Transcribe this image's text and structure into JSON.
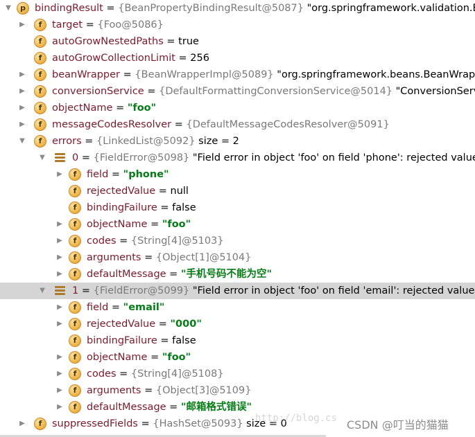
{
  "tree": [
    {
      "depth": 0,
      "expander": "expanded",
      "icon": "p",
      "name": "bindingResult",
      "ref": "{BeanPropertyBindingResult@5087}",
      "value": "\"org.springframework.validation.Be",
      "value_kind": "plain"
    },
    {
      "depth": 1,
      "expander": "collapsed",
      "icon": "f",
      "name": "target",
      "ref": "{Foo@5086}",
      "value": "",
      "value_kind": "plain"
    },
    {
      "depth": 1,
      "expander": "none",
      "icon": "f",
      "name": "autoGrowNestedPaths",
      "ref": "",
      "value": "true",
      "value_kind": "plain"
    },
    {
      "depth": 1,
      "expander": "none",
      "icon": "f",
      "name": "autoGrowCollectionLimit",
      "ref": "",
      "value": "256",
      "value_kind": "plain"
    },
    {
      "depth": 1,
      "expander": "collapsed",
      "icon": "f",
      "name": "beanWrapper",
      "ref": "{BeanWrapperImpl@5089}",
      "value": "\"org.springframework.beans.BeanWrapp",
      "value_kind": "plain"
    },
    {
      "depth": 1,
      "expander": "collapsed",
      "icon": "f",
      "name": "conversionService",
      "ref": "{DefaultFormattingConversionService@5014}",
      "value": "\"ConversionServi",
      "value_kind": "plain"
    },
    {
      "depth": 1,
      "expander": "collapsed",
      "icon": "f",
      "name": "objectName",
      "ref": "",
      "value": "\"foo\"",
      "value_kind": "str"
    },
    {
      "depth": 1,
      "expander": "collapsed",
      "icon": "f",
      "name": "messageCodesResolver",
      "ref": "{DefaultMessageCodesResolver@5091}",
      "value": "",
      "value_kind": "plain"
    },
    {
      "depth": 1,
      "expander": "expanded",
      "icon": "f",
      "name": "errors",
      "ref": "{LinkedList@5092}",
      "value": "size = 2",
      "value_kind": "plain"
    },
    {
      "depth": 2,
      "expander": "expanded",
      "icon": "list",
      "name": "0",
      "ref": "{FieldError@5098}",
      "value": "\"Field error in object 'foo' on field 'phone': rejected value",
      "value_kind": "plain"
    },
    {
      "depth": 3,
      "expander": "collapsed",
      "icon": "f",
      "name": "field",
      "ref": "",
      "value": "\"phone\"",
      "value_kind": "str"
    },
    {
      "depth": 3,
      "expander": "none",
      "icon": "f",
      "name": "rejectedValue",
      "ref": "",
      "value": "null",
      "value_kind": "plain"
    },
    {
      "depth": 3,
      "expander": "none",
      "icon": "f",
      "name": "bindingFailure",
      "ref": "",
      "value": "false",
      "value_kind": "plain"
    },
    {
      "depth": 3,
      "expander": "collapsed",
      "icon": "f",
      "name": "objectName",
      "ref": "",
      "value": "\"foo\"",
      "value_kind": "str"
    },
    {
      "depth": 3,
      "expander": "collapsed",
      "icon": "f",
      "name": "codes",
      "ref": "{String[4]@5103}",
      "value": "",
      "value_kind": "plain"
    },
    {
      "depth": 3,
      "expander": "collapsed",
      "icon": "f",
      "name": "arguments",
      "ref": "{Object[1]@5104}",
      "value": "",
      "value_kind": "plain"
    },
    {
      "depth": 3,
      "expander": "collapsed",
      "icon": "f",
      "name": "defaultMessage",
      "ref": "",
      "value": "\"手机号码不能为空\"",
      "value_kind": "str"
    },
    {
      "depth": 2,
      "expander": "expanded",
      "icon": "list",
      "name": "1",
      "ref": "{FieldError@5099}",
      "value": "\"Field error in object 'foo' on field 'email': rejected value [0",
      "value_kind": "plain",
      "selected": true
    },
    {
      "depth": 3,
      "expander": "collapsed",
      "icon": "f",
      "name": "field",
      "ref": "",
      "value": "\"email\"",
      "value_kind": "str"
    },
    {
      "depth": 3,
      "expander": "collapsed",
      "icon": "f",
      "name": "rejectedValue",
      "ref": "",
      "value": "\"000\"",
      "value_kind": "str"
    },
    {
      "depth": 3,
      "expander": "none",
      "icon": "f",
      "name": "bindingFailure",
      "ref": "",
      "value": "false",
      "value_kind": "plain"
    },
    {
      "depth": 3,
      "expander": "collapsed",
      "icon": "f",
      "name": "objectName",
      "ref": "",
      "value": "\"foo\"",
      "value_kind": "str"
    },
    {
      "depth": 3,
      "expander": "collapsed",
      "icon": "f",
      "name": "codes",
      "ref": "{String[4]@5108}",
      "value": "",
      "value_kind": "plain"
    },
    {
      "depth": 3,
      "expander": "collapsed",
      "icon": "f",
      "name": "arguments",
      "ref": "{Object[3]@5109}",
      "value": "",
      "value_kind": "plain"
    },
    {
      "depth": 3,
      "expander": "collapsed",
      "icon": "f",
      "name": "defaultMessage",
      "ref": "",
      "value": "\"邮箱格式错误\"",
      "value_kind": "str"
    },
    {
      "depth": 1,
      "expander": "collapsed",
      "icon": "f",
      "name": "suppressedFields",
      "ref": "{HashSet@5093}",
      "value": "size = 0",
      "value_kind": "plain"
    }
  ],
  "watermark": {
    "url": "http://blog.cs",
    "credit": "CSDN @叮当的猫猫"
  },
  "colors": {
    "name": "#7b1b30",
    "reference": "#7a7a7a",
    "string": "#067d17",
    "selected_row": "#d5d5d5",
    "icon": "#f0b94e"
  }
}
